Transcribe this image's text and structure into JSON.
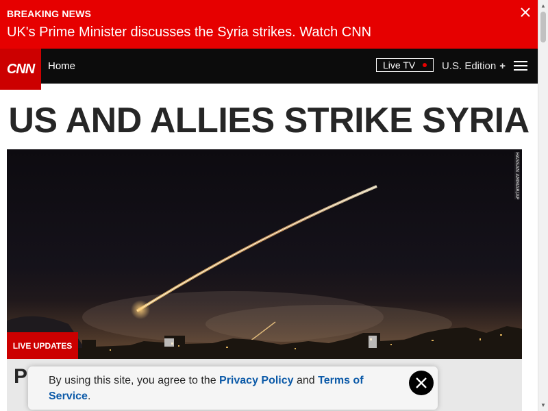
{
  "breaking": {
    "kicker": "BREAKING NEWS",
    "headline": "UK's Prime Minister discusses the Syria strikes. Watch CNN",
    "close_icon": "close-icon"
  },
  "nav": {
    "logo": "CNN",
    "home_label": "Home",
    "live_tv_label": "Live TV",
    "edition_label": "U.S. Edition",
    "edition_plus": "+",
    "menu_icon": "hamburger-menu-icon"
  },
  "page": {
    "headline": "US AND ALLIES STRIKE SYRIA"
  },
  "hero": {
    "credit": "HASSAN AMMAR/AP",
    "badge": "LIVE UPDATES",
    "story_title": "P"
  },
  "consent": {
    "prefix": "By using this site, you agree to the ",
    "privacy_label": "Privacy Policy",
    "and": " and ",
    "terms_label": "Terms of Service",
    "suffix": "."
  },
  "colors": {
    "brand_red": "#cc0000",
    "banner_red": "#e60000",
    "nav_black": "#0c0c0c",
    "link_blue": "#0c5aa8"
  }
}
